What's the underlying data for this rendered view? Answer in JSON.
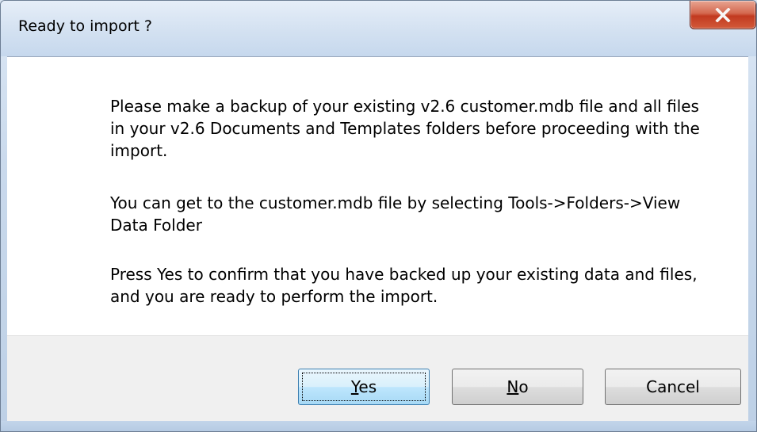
{
  "window": {
    "title": "Ready to import ?"
  },
  "message": {
    "paragraph1": "Please make a backup of your existing v2.6 customer.mdb file and all files in your v2.6 Documents and Templates folders before proceeding with the import.",
    "paragraph2": "You can get to the customer.mdb file by selecting Tools->Folders->View Data Folder",
    "paragraph3": "Press Yes to confirm that you have backed up your existing data and files, and you are ready to perform the import."
  },
  "buttons": {
    "yes": {
      "mnemonic": "Y",
      "rest": "es"
    },
    "no": {
      "mnemonic": "N",
      "rest": "o"
    },
    "cancel": "Cancel"
  },
  "icons": {
    "close": "close-icon"
  },
  "colors": {
    "close_button": "#c23a20",
    "default_button_border": "#3c7fb1",
    "content_background": "#ffffff",
    "footer_background": "#f0f0f0"
  }
}
